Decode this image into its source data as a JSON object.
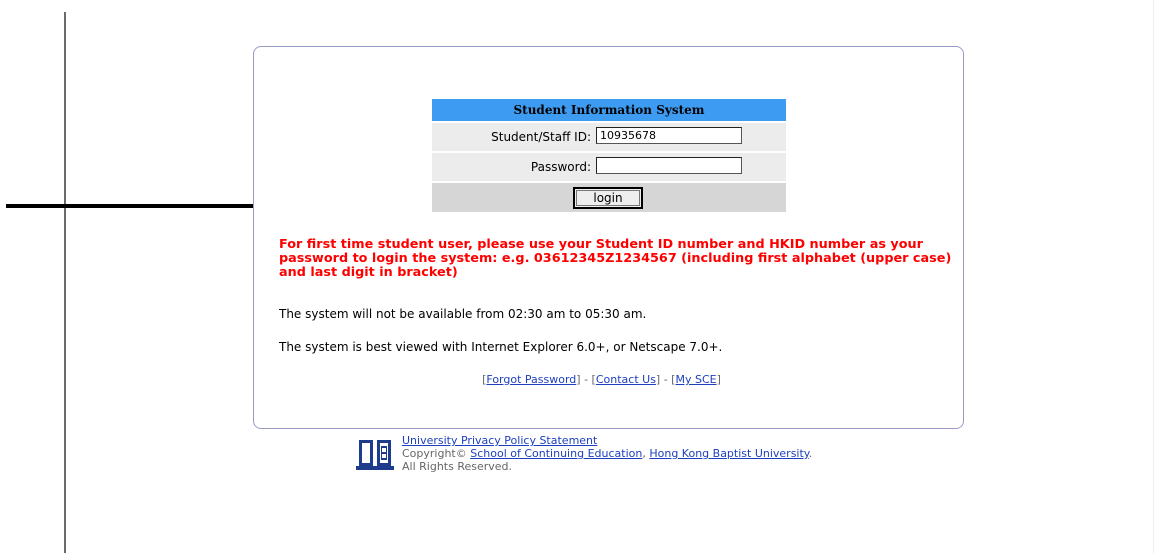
{
  "login": {
    "title": "Student Information System",
    "id_label": "Student/Staff ID:",
    "id_value": "10935678",
    "password_label": "Password:",
    "password_value": "",
    "button_label": "login"
  },
  "notice": {
    "first_time": "For first time student user, please use your Student ID number and HKID number as your password to login the system: e.g. 03612345Z1234567 (including first alphabet (upper case) and last digit in bracket)",
    "availability": "The system will not be available from 02:30 am to 05:30 am.",
    "browser": "The system is best viewed with Internet Explorer 6.0+, or Netscape 7.0+."
  },
  "links": {
    "open": "[",
    "forgot": "Forgot Password",
    "sep1": "] - [",
    "contact": "Contact Us",
    "sep2": "] - [",
    "mysce": "My SCE",
    "close": "]"
  },
  "footer": {
    "privacy": "University Privacy Policy Statement",
    "copyright_prefix": "Copyright©",
    "sce": "School of Continuing Education",
    "comma": ",",
    "hkbu": "Hong Kong Baptist University",
    "period": ".",
    "rights": "All Rights Reserved."
  },
  "colors": {
    "title_bar": "#3d9bf2",
    "notice": "#ff0000",
    "link": "#1d3fbf",
    "panel_border": "#9a9ac6"
  }
}
